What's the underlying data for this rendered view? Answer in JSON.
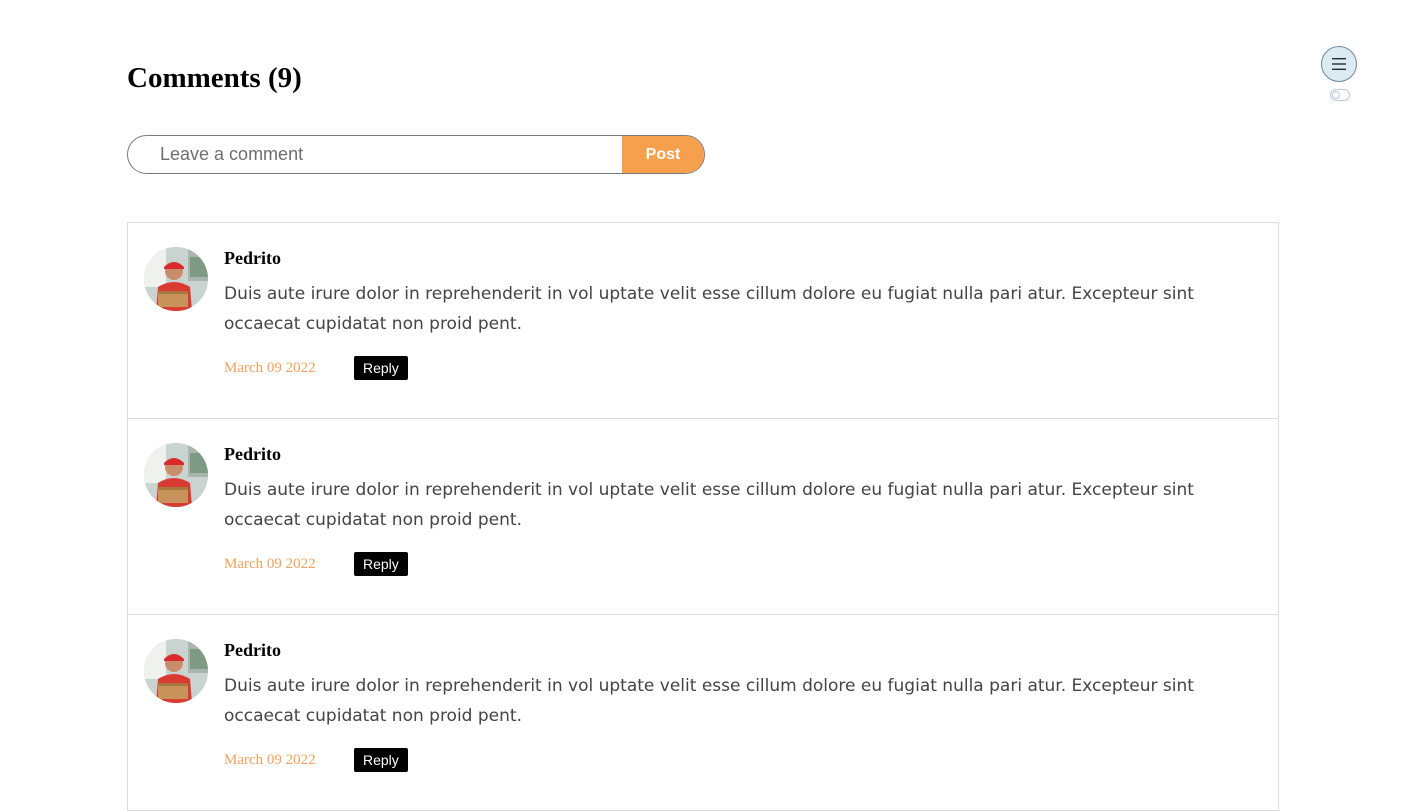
{
  "header": {
    "title": "Comments (9)"
  },
  "comment_form": {
    "placeholder": "Leave a comment",
    "value": "",
    "post_label": "Post"
  },
  "comments": [
    {
      "author": "Pedrito",
      "text": "Duis aute irure dolor in reprehenderit in vol uptate velit esse cillum dolore eu fugiat nulla pari atur. Excepteur sint occaecat cupidatat non proid pent.",
      "date": "March 09 2022",
      "reply_label": "Reply"
    },
    {
      "author": "Pedrito",
      "text": "Duis aute irure dolor in reprehenderit in vol uptate velit esse cillum dolore eu fugiat nulla pari atur. Excepteur sint occaecat cupidatat non proid pent.",
      "date": "March 09 2022",
      "reply_label": "Reply"
    },
    {
      "author": "Pedrito",
      "text": "Duis aute irure dolor in reprehenderit in vol uptate velit esse cillum dolore eu fugiat nulla pari atur. Excepteur sint occaecat cupidatat non proid pent.",
      "date": "March 09 2022",
      "reply_label": "Reply"
    }
  ],
  "controls": {
    "menu_icon": "hamburger-menu-icon",
    "toggle_icon": "toggle-switch"
  },
  "colors": {
    "accent": "#f6a04d",
    "date": "#f2a15c",
    "reply_bg": "#000000"
  }
}
